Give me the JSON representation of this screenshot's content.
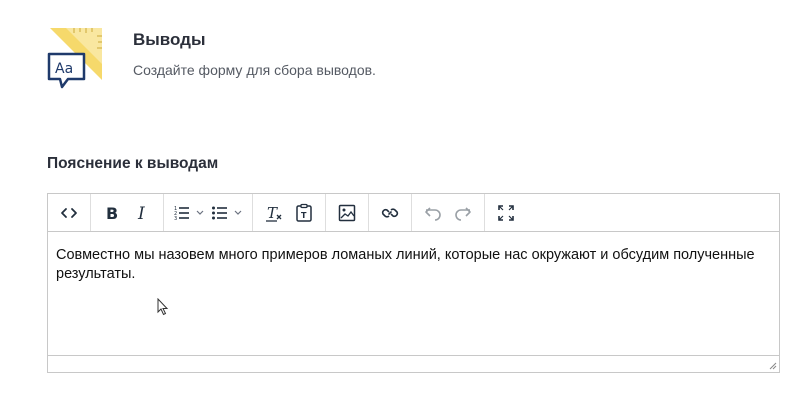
{
  "header": {
    "title": "Выводы",
    "subtitle": "Создайте форму для сбора выводов.",
    "logo_text": "Aa"
  },
  "field": {
    "label": "Пояснение к выводам"
  },
  "editor": {
    "content": "Совместно мы назовем много примеров ломаных линий, которые нас окружают и обсудим полученные результаты."
  },
  "toolbar": {
    "buttons": [
      {
        "icon": "code-view-icon"
      },
      {
        "icon": "bold-icon"
      },
      {
        "icon": "italic-icon"
      },
      {
        "icon": "numbered-list-icon"
      },
      {
        "icon": "bulleted-list-icon"
      },
      {
        "icon": "clear-formatting-icon"
      },
      {
        "icon": "paste-as-text-icon"
      },
      {
        "icon": "insert-image-icon"
      },
      {
        "icon": "insert-link-icon"
      },
      {
        "icon": "undo-icon",
        "disabled": true
      },
      {
        "icon": "redo-icon",
        "disabled": true
      },
      {
        "icon": "fullscreen-icon"
      }
    ]
  },
  "colors": {
    "logo_yellow": "#f6d96b",
    "logo_navy": "#1f3a6b",
    "border": "#c8c8c8",
    "icon": "#222f3e"
  }
}
